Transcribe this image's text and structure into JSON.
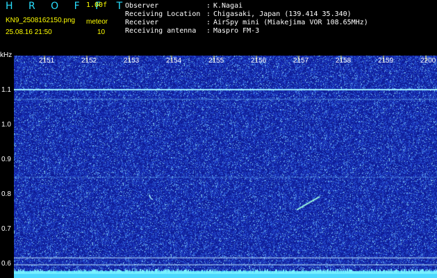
{
  "header": {
    "brand": "H R O F F T",
    "version": "1.00f",
    "filename": "KN9_2508162150.png",
    "meteor_label": "meteor",
    "datetime": "25.08.16 21:50",
    "meteor_count": "10",
    "fields": [
      {
        "label": "Observer",
        "value": "K.Nagai"
      },
      {
        "label": "Receiving Location",
        "value": "Chigasaki, Japan (139.414 35.340)"
      },
      {
        "label": "Receiver",
        "value": "AirSpy mini (Miakejima VOR 108.65MHz)"
      },
      {
        "label": "Receiving antenna",
        "value": "Maspro FM-3"
      }
    ]
  },
  "axis": {
    "unit": "kHz",
    "y_ticks": [
      "1.1",
      "1.0",
      "0.9",
      "0.8",
      "0.7",
      "0.6"
    ],
    "x_ticks": [
      "2151",
      "2152",
      "2153",
      "2154",
      "2155",
      "2156",
      "2157",
      "2158",
      "2159",
      "2200"
    ]
  },
  "colors": {
    "background": "#000000",
    "noise": "#1a2fb0",
    "carrier": "#8fe0ff",
    "label": "#ffffff",
    "accent": "#ffff00",
    "brand": "#29e0ff"
  }
}
